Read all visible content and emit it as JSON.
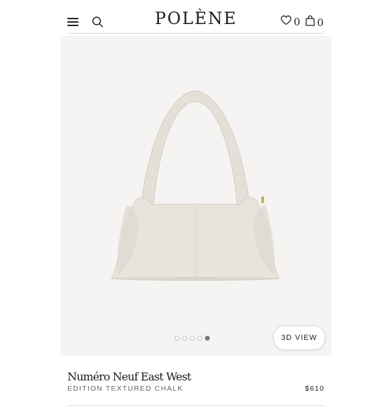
{
  "header": {
    "logo": "POLÈNE",
    "wishlist_count": "0",
    "cart_count": "0",
    "icons": [
      "menu-icon",
      "search-icon",
      "heart-icon",
      "bag-icon"
    ]
  },
  "gallery": {
    "slides_total": 5,
    "active_slide": 5,
    "view_3d_label": "3D VIEW",
    "product_image": "cream shoulder bag"
  },
  "product": {
    "name": "Numéro Neuf East West",
    "edition": "EDITION TEXTURED CHALK",
    "price": "$610"
  },
  "colors": {
    "background": "#f5f4f2",
    "bag": "#e6e2da",
    "text": "#1a1a1a"
  }
}
